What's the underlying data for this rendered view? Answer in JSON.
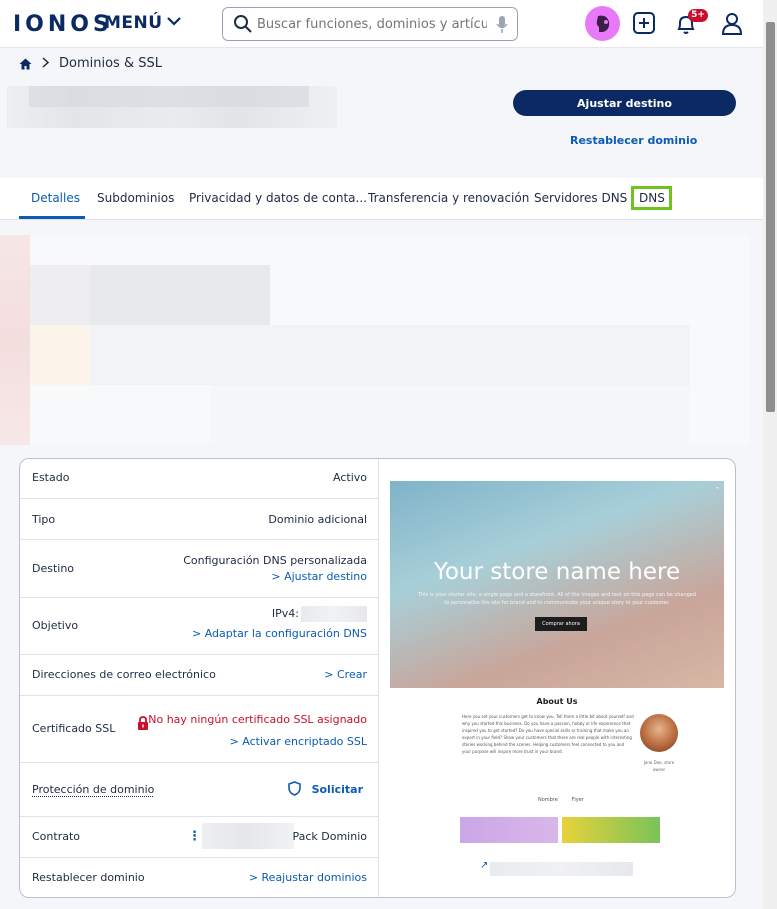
{
  "header": {
    "logo": "IONOS",
    "menu_label": "MENÚ",
    "search_placeholder": "Buscar funciones, dominios y artículo...",
    "notifications_badge": "5+"
  },
  "breadcrumb": {
    "item": "Dominios & SSL"
  },
  "actions": {
    "primary": "Ajustar destino",
    "secondary": "Restablecer dominio"
  },
  "tabs": [
    {
      "label": "Detalles",
      "active": true
    },
    {
      "label": "Subdominios"
    },
    {
      "label": "Privacidad y datos de conta..."
    },
    {
      "label": "Transferencia y renovación"
    },
    {
      "label": "Servidores DNS"
    },
    {
      "label": "DNS",
      "highlighted": true
    }
  ],
  "details": {
    "estado": {
      "label": "Estado",
      "value": "Activo"
    },
    "tipo": {
      "label": "Tipo",
      "value": "Dominio adicional"
    },
    "destino": {
      "label": "Destino",
      "value": "Configuración DNS personalizada",
      "link": "> Ajustar destino"
    },
    "objetivo": {
      "label": "Objetivo",
      "value": "IPv4:",
      "link": "> Adaptar la configuración DNS"
    },
    "correo": {
      "label": "Direcciones de correo electrónico",
      "link": "> Crear"
    },
    "ssl": {
      "label": "Certificado SSL",
      "error": "No hay ningún certificado SSL asignado",
      "link": "> Activar encriptado SSL"
    },
    "proteccion": {
      "label": "Protección de dominio",
      "action": "Solicitar"
    },
    "contrato": {
      "label": "Contrato",
      "value": "Pack Dominio"
    },
    "restablecer": {
      "label": "Restablecer dominio",
      "link": "> Reajustar dominios"
    }
  },
  "preview": {
    "hero_title": "Your store name here",
    "hero_sub": "This is your starter site, a single page and a storefront. All of the images and text on this page can be changed to personalize the site for brand and to communicate your unique story to your customer.",
    "hero_button": "Comprar ahora",
    "about_title": "About Us",
    "about_text": "Here you set your customers get to know you. Tell them a little bit about yourself and why you started this business. Do you have a passion, hobby or life experience that inspired you to get started? Do you have special skills or training that make you an expert in your field? Show your customers that there are real people with interesting stories working behind the scenes. Helping customers feel connected to you and your purpose will inspire more trust in your brand.",
    "avatar_caption": "Jane Doe, store owner",
    "nav": "Nombre Flyer",
    "link_arrow": "↗"
  },
  "colors": {
    "brand": "#0b2a63",
    "link": "#0b5bb5",
    "error": "#c8102e",
    "highlight": "#6fc31c"
  }
}
